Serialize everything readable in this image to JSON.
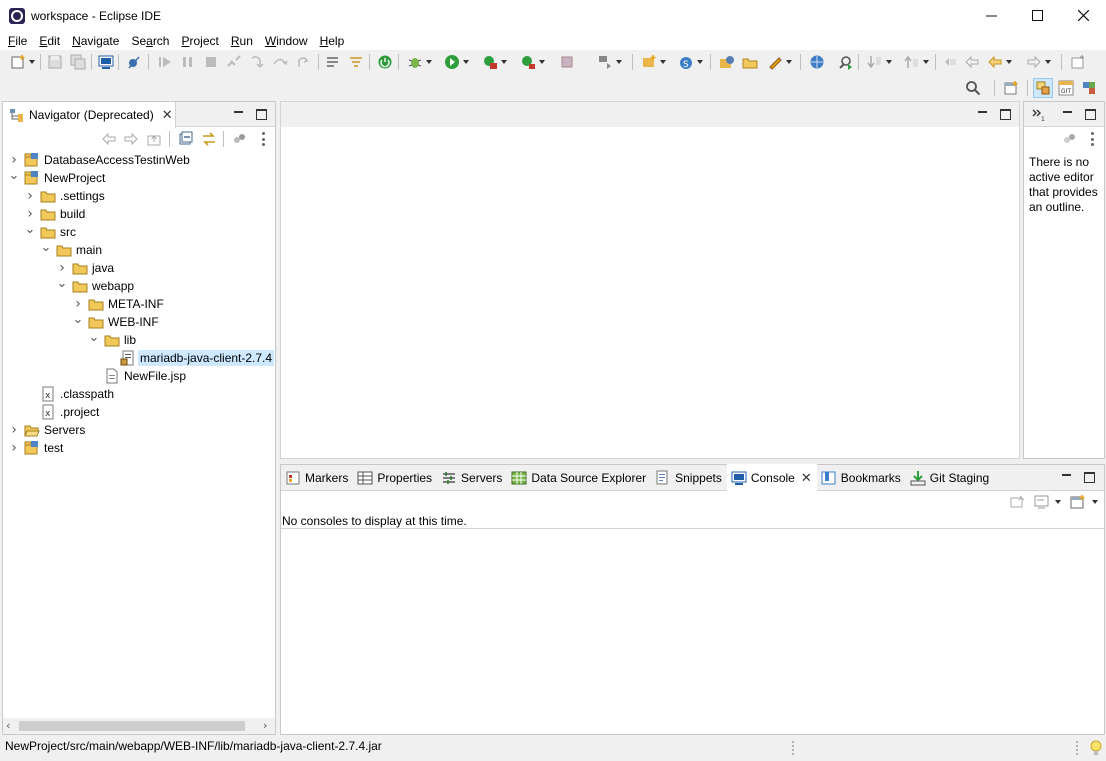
{
  "window": {
    "title": "workspace - Eclipse IDE",
    "controls": [
      "minimize",
      "maximize",
      "close"
    ]
  },
  "menu": [
    {
      "label": "File",
      "mnemonic": "F",
      "rest": "ile"
    },
    {
      "label": "Edit",
      "mnemonic": "E",
      "rest": "dit"
    },
    {
      "label": "Navigate",
      "mnemonic": "N",
      "rest": "avigate"
    },
    {
      "label": "Search",
      "mnemonic": "a",
      "pre": "Se",
      "rest": "rch"
    },
    {
      "label": "Project",
      "mnemonic": "P",
      "rest": "roject"
    },
    {
      "label": "Run",
      "mnemonic": "R",
      "rest": "un"
    },
    {
      "label": "Window",
      "mnemonic": "W",
      "rest": "indow"
    },
    {
      "label": "Help",
      "mnemonic": "H",
      "rest": "elp"
    }
  ],
  "navigator": {
    "tab_label": "Navigator (Deprecated)",
    "tree": [
      {
        "label": "DatabaseAccessTestinWeb",
        "depth": 0,
        "state": "collapsed",
        "icon": "project-icon"
      },
      {
        "label": "NewProject",
        "depth": 0,
        "state": "expanded",
        "icon": "project-icon"
      },
      {
        "label": ".settings",
        "depth": 1,
        "state": "collapsed",
        "icon": "folder-icon"
      },
      {
        "label": "build",
        "depth": 1,
        "state": "collapsed",
        "icon": "folder-icon"
      },
      {
        "label": "src",
        "depth": 1,
        "state": "expanded",
        "icon": "folder-icon"
      },
      {
        "label": "main",
        "depth": 2,
        "state": "expanded",
        "icon": "folder-icon"
      },
      {
        "label": "java",
        "depth": 3,
        "state": "collapsed",
        "icon": "folder-icon"
      },
      {
        "label": "webapp",
        "depth": 3,
        "state": "expanded",
        "icon": "folder-icon"
      },
      {
        "label": "META-INF",
        "depth": 4,
        "state": "collapsed",
        "icon": "folder-icon"
      },
      {
        "label": "WEB-INF",
        "depth": 4,
        "state": "expanded",
        "icon": "folder-icon"
      },
      {
        "label": "lib",
        "depth": 5,
        "state": "expanded",
        "icon": "folder-icon"
      },
      {
        "label": "mariadb-java-client-2.7.4",
        "depth": 6,
        "state": "leaf",
        "icon": "jar-file-icon",
        "selected": true
      },
      {
        "label": "NewFile.jsp",
        "depth": 5,
        "state": "leaf",
        "icon": "jsp-file-icon"
      },
      {
        "label": ".classpath",
        "depth": 1,
        "state": "leaf",
        "icon": "xml-file-icon"
      },
      {
        "label": ".project",
        "depth": 1,
        "state": "leaf",
        "icon": "xml-file-icon"
      },
      {
        "label": "Servers",
        "depth": 0,
        "state": "collapsed",
        "icon": "open-folder-icon"
      },
      {
        "label": "test",
        "depth": 0,
        "state": "collapsed",
        "icon": "project-icon"
      }
    ]
  },
  "outline": {
    "message_lines": [
      "There is no",
      "active editor",
      "that provides",
      "an outline."
    ]
  },
  "bottom_tabs": [
    {
      "label": "Markers",
      "icon": "markers-icon",
      "active": false
    },
    {
      "label": "Properties",
      "icon": "properties-icon",
      "active": false
    },
    {
      "label": "Servers",
      "icon": "servers-icon",
      "active": false
    },
    {
      "label": "Data Source Explorer",
      "icon": "data-source-icon",
      "active": false
    },
    {
      "label": "Snippets",
      "icon": "snippets-icon",
      "active": false
    },
    {
      "label": "Console",
      "icon": "console-icon",
      "active": true
    },
    {
      "label": "Bookmarks",
      "icon": "bookmarks-icon",
      "active": false
    },
    {
      "label": "Git Staging",
      "icon": "git-staging-icon",
      "active": false
    }
  ],
  "console": {
    "message": "No consoles to display at this time."
  },
  "status_bar": {
    "text": "NewProject/src/main/webapp/WEB-INF/lib/mariadb-java-client-2.7.4.jar"
  },
  "colors": {
    "selection": "#cde8ff",
    "folder": "#e8b64a",
    "chrome": "#f0f0f0"
  }
}
